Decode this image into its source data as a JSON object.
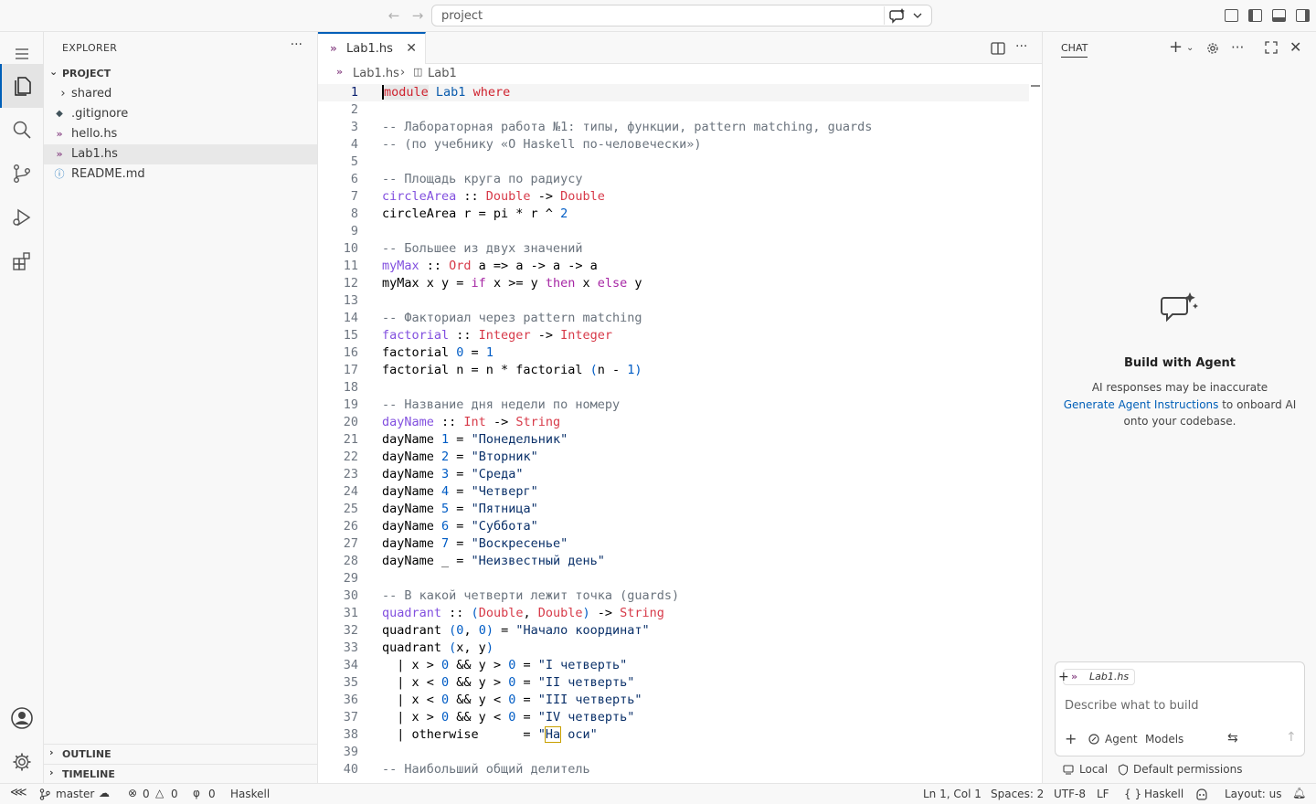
{
  "titlebar": {
    "search_text": "project"
  },
  "explorer": {
    "title": "EXPLORER",
    "project_label": "PROJECT",
    "items": [
      {
        "name": "shared",
        "type": "folder"
      },
      {
        "name": ".gitignore",
        "type": "gitignore"
      },
      {
        "name": "hello.hs",
        "type": "haskell"
      },
      {
        "name": "Lab1.hs",
        "type": "haskell"
      },
      {
        "name": "README.md",
        "type": "info"
      }
    ],
    "outline_label": "OUTLINE",
    "timeline_label": "TIMELINE"
  },
  "editor": {
    "tab_label": "Lab1.hs",
    "breadcrumb_file": "Lab1.hs",
    "breadcrumb_symbol": "Lab1",
    "lines": [
      "1",
      "2",
      "3",
      "4",
      "5",
      "6",
      "7",
      "8",
      "9",
      "10",
      "11",
      "12",
      "13",
      "14",
      "15",
      "16",
      "17",
      "18",
      "19",
      "20",
      "21",
      "22",
      "23",
      "24",
      "25",
      "26",
      "27",
      "28",
      "29",
      "30",
      "31",
      "32",
      "33",
      "34",
      "35",
      "36",
      "37",
      "38",
      "39",
      "40"
    ]
  },
  "chat": {
    "tab_label": "CHAT",
    "title": "Build with Agent",
    "line1": "AI responses may be inaccurate",
    "link": "Generate Agent Instructions",
    "line2_rest": " to onboard AI",
    "line3": "onto your codebase.",
    "context_file": "Lab1.hs",
    "input_placeholder": "Describe what to build",
    "agent_label": "Agent",
    "models_label": "Models",
    "local_label": "Local",
    "permissions_label": "Default permissions"
  },
  "status": {
    "branch": "master",
    "errors": "0",
    "warnings": "0",
    "ports": "0",
    "language_left": "Haskell",
    "position": "Ln 1, Col 1",
    "spaces": "Spaces: 2",
    "encoding": "UTF-8",
    "eol": "LF",
    "language": "Haskell",
    "layout": "Layout: us"
  }
}
